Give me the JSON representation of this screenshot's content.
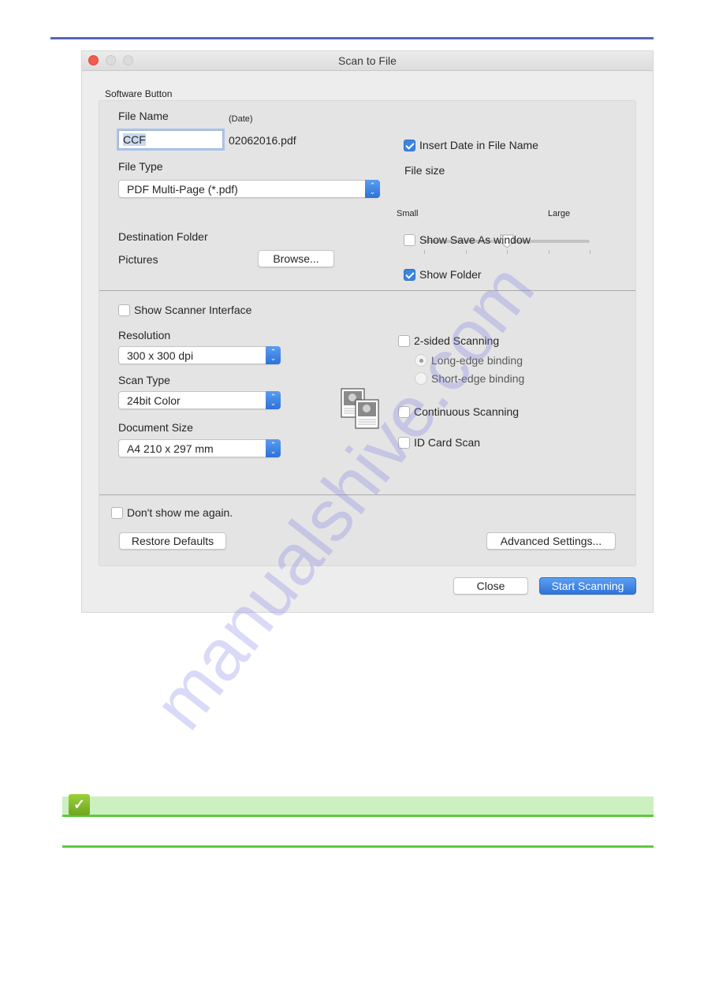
{
  "window": {
    "title": "Scan to File",
    "group_label": "Software Button"
  },
  "file_section": {
    "file_name_label": "File Name",
    "file_name_value": "CCF",
    "date_label": "(Date)",
    "date_suffix": "02062016.pdf",
    "insert_date_label": "Insert Date in File Name",
    "insert_date_checked": true,
    "file_type_label": "File Type",
    "file_type_value": "PDF Multi-Page (*.pdf)",
    "file_size_label": "File size",
    "file_size_min_label": "Small",
    "file_size_max_label": "Large",
    "file_size_level_percent": 50,
    "file_size_ticks": 5,
    "destination_label": "Destination Folder",
    "destination_value": "Pictures",
    "browse_label": "Browse...",
    "show_save_as_label": "Show Save As window",
    "show_save_as_checked": false,
    "show_folder_label": "Show Folder",
    "show_folder_checked": true
  },
  "scan_section": {
    "show_scanner_interface_label": "Show Scanner Interface",
    "show_scanner_interface_checked": false,
    "resolution_label": "Resolution",
    "resolution_value": "300 x 300 dpi",
    "scan_type_label": "Scan Type",
    "scan_type_value": "24bit Color",
    "document_size_label": "Document Size",
    "document_size_value": "A4 210 x 297 mm",
    "two_sided_label": "2-sided Scanning",
    "two_sided_checked": false,
    "long_edge_label": "Long-edge binding",
    "long_edge_selected": true,
    "short_edge_label": "Short-edge binding",
    "short_edge_selected": false,
    "continuous_label": "Continuous Scanning",
    "continuous_checked": false,
    "id_card_label": "ID Card Scan",
    "id_card_checked": false,
    "icon": "duplex-document-icon"
  },
  "footer": {
    "dont_show_label": "Don't show me again.",
    "dont_show_checked": false,
    "restore_defaults_label": "Restore Defaults",
    "advanced_settings_label": "Advanced Settings...",
    "close_label": "Close",
    "start_scanning_label": "Start Scanning"
  },
  "page": {
    "note_icon": "checkmark-icon",
    "watermark": "manualshive.com"
  },
  "colors": {
    "accent_blue": "#3b85e0",
    "close_traffic": "#f25c4c",
    "note_green": "#5ccb3c",
    "header_rule": "#5566bb"
  }
}
